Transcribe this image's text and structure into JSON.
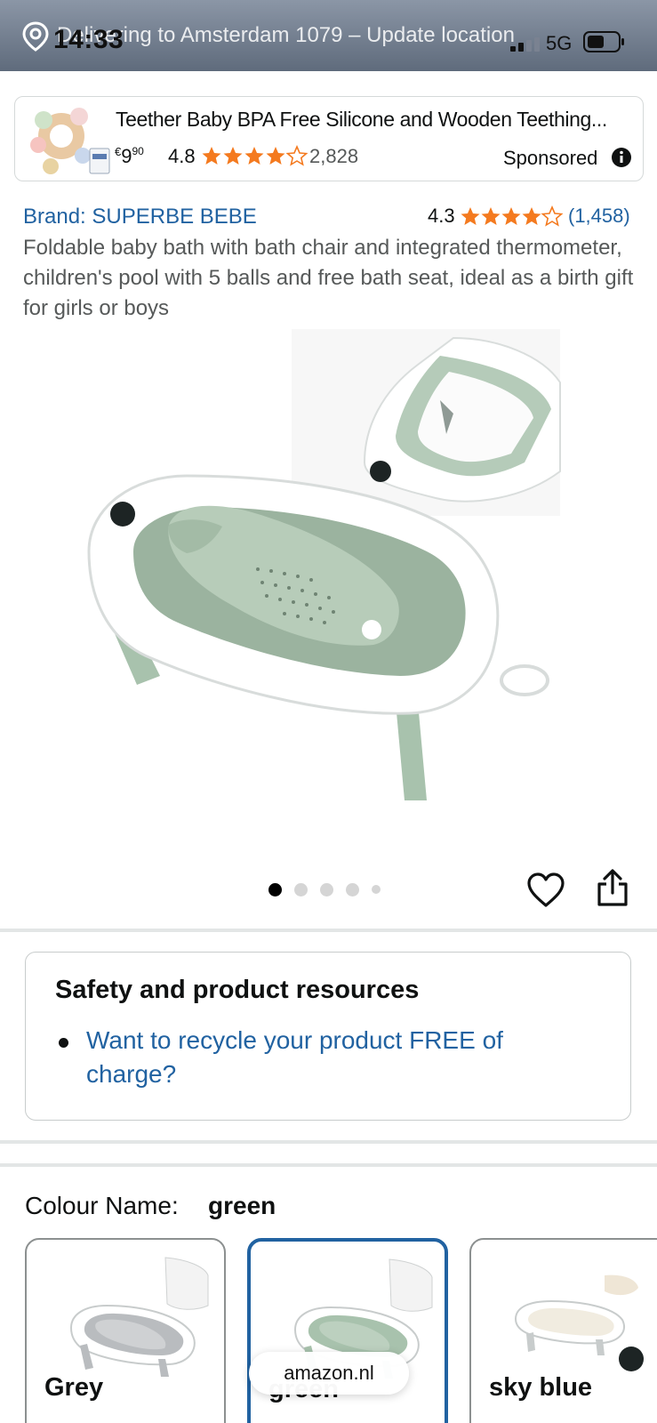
{
  "status_bar": {
    "time": "14:33",
    "network": "5G",
    "delivery_text": "Delivering to Amsterdam 1079 – Update location"
  },
  "sponsored_ad": {
    "title": "Teether Baby BPA Free Silicone and Wooden Teething...",
    "price_currency": "€",
    "price_whole": "9",
    "price_fraction": "90",
    "rating": "4.8",
    "review_count": "2,828",
    "sponsored_label": "Sponsored",
    "star_fill": 4.5
  },
  "product": {
    "brand": "Brand: SUPERBE BEBE",
    "rating": "4.3",
    "star_fill": 4.5,
    "review_count": "(1,458)",
    "title": "Foldable baby bath with bath chair and integrated thermometer, children's pool with 5 balls and free bath seat, ideal as a birth gift for girls or boys",
    "image_count": 5,
    "active_image": 1
  },
  "safety": {
    "heading": "Safety and product resources",
    "link": "Want to recycle your product FREE of charge?"
  },
  "colour": {
    "label": "Colour Name:",
    "selected": "green",
    "options": [
      {
        "name": "Grey",
        "color": "#b9bcbf"
      },
      {
        "name": "green",
        "color": "#a8c2ad"
      },
      {
        "name": "sky blue",
        "color": "#f1ece0"
      }
    ]
  },
  "browser": {
    "url": "amazon.nl"
  },
  "colors": {
    "link": "#2162a1",
    "star": "#f47a1f",
    "tub_green": "#a8c2ad"
  }
}
